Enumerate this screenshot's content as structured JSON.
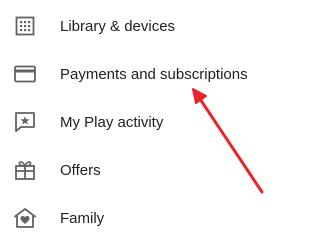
{
  "menu": {
    "items": [
      {
        "label": "Library & devices",
        "icon": "library-devices-icon"
      },
      {
        "label": "Payments and subscriptions",
        "icon": "credit-card-icon"
      },
      {
        "label": "My Play activity",
        "icon": "play-activity-icon"
      },
      {
        "label": "Offers",
        "icon": "gift-icon"
      },
      {
        "label": "Family",
        "icon": "family-icon"
      }
    ]
  },
  "colors": {
    "icon": "#5f6368",
    "text": "#202124",
    "annotation_arrow": "#e8242a"
  }
}
